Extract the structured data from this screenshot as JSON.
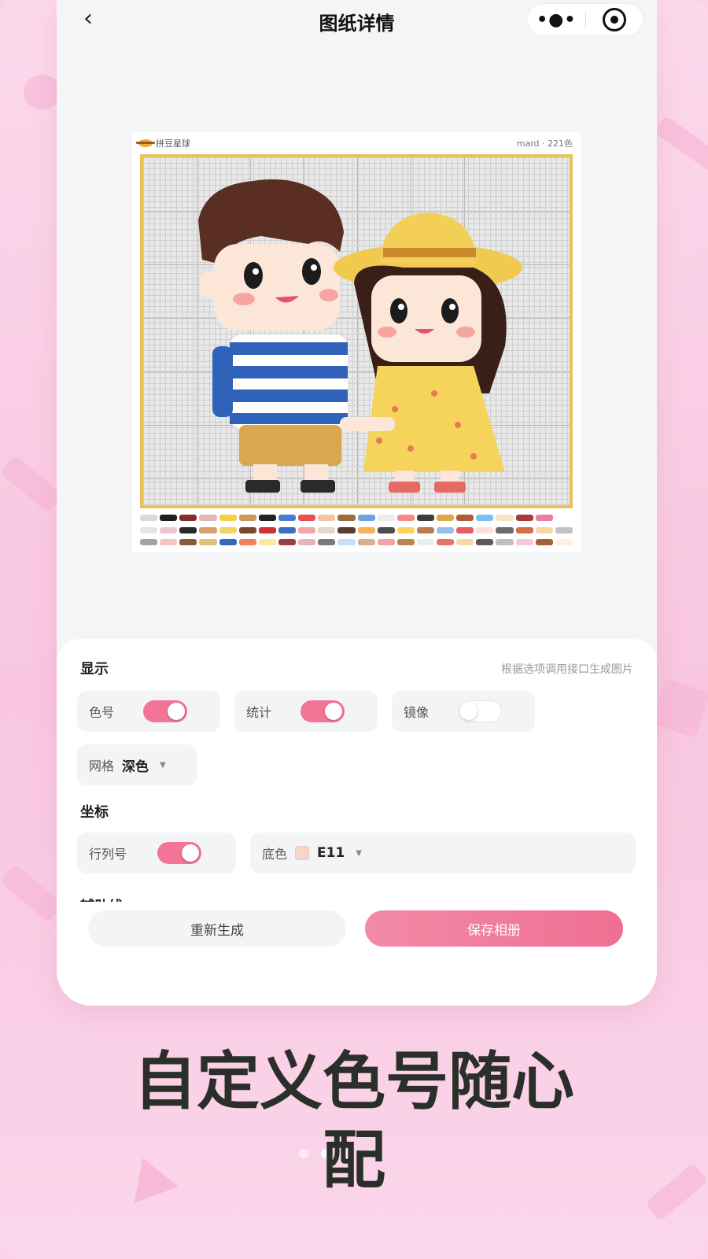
{
  "navbar": {
    "title": "图纸详情",
    "back_icon": "chevron-left-icon",
    "more_icon": "more-dots-icon",
    "target_icon": "target-icon"
  },
  "pattern": {
    "brand": "拼豆星球",
    "meta": "mard · 221色",
    "palette_colors": [
      "#d9d9d9",
      "#1e1e1e",
      "#8a2b2b",
      "#e7b5b5",
      "#f2d04a",
      "#c99a5a",
      "#222",
      "#4a7bd1",
      "#e65252",
      "#f5c2a3",
      "#9c6d3a",
      "#6aa3e0",
      "#ececec",
      "#f28a8a",
      "#3d3d3d",
      "#e0a848",
      "#b15a34",
      "#7dc0f0",
      "#f7e2c8",
      "#a83a3a",
      "#e9809c",
      "#ffffff",
      "#e5e5e5",
      "#f0c6d0",
      "#2a2a2a",
      "#d8a06a",
      "#eed56a",
      "#7a4a2a",
      "#cc3333",
      "#3b6ec4",
      "#f4a7a7",
      "#e7d7c9",
      "#5a3d2b",
      "#f3b45c",
      "#4d4d4d",
      "#ffd35a",
      "#bb7b4a",
      "#93c2e8",
      "#e85c5c",
      "#fce1d5",
      "#6b6b6b",
      "#d16f4a",
      "#f9d8a6",
      "#c2c2c2",
      "#a3a3a3",
      "#f5c5c5",
      "#8b5a3c",
      "#e3c07a",
      "#306ab8",
      "#f07f5c",
      "#ffe9a0",
      "#9d3f3f",
      "#e8b2c2",
      "#7a7a7a",
      "#c8e0f5",
      "#d9b08c",
      "#f2a2a2",
      "#b8864a",
      "#ededed",
      "#e4746c",
      "#f6d9a3",
      "#5a5a5a",
      "#bfbfbf",
      "#f6c9d9",
      "#a55d3a",
      "#fdf0e3"
    ]
  },
  "settings": {
    "display_title": "显示",
    "hint": "根据选项调用接口生成图片",
    "color_code_label": "色号",
    "color_code_on": true,
    "stats_label": "统计",
    "stats_on": true,
    "mirror_label": "镜像",
    "mirror_on": false,
    "grid_label": "网格",
    "grid_value": "深色",
    "coord_title": "坐标",
    "rowcol_label": "行列号",
    "rowcol_on": true,
    "bgcolor_label": "底色",
    "bgcolor_value": "E11",
    "bgcolor_swatch": "#f6d6c8",
    "next_section": "辅助线",
    "regen_button": "重新生成",
    "save_button": "保存相册",
    "accent": "#f27597"
  },
  "promo": {
    "line1": "自定义色号随心",
    "line2": "配"
  }
}
